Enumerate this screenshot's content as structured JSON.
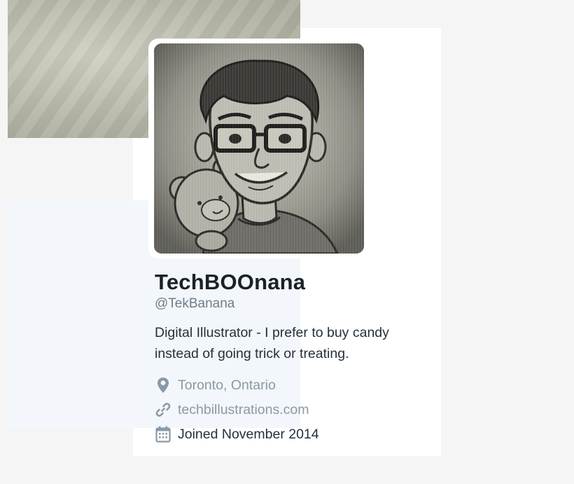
{
  "profile": {
    "display_name": "TechBOOnana",
    "handle": "@TekBanana",
    "bio_line1": "Digital Illustrator - I prefer to buy candy",
    "bio_line2": "instead of going trick or treating.",
    "location": "Toronto, Ontario",
    "website": "techbillustrations.com",
    "joined": "Joined November 2014"
  },
  "icons": {
    "location": "map-pin-icon",
    "website": "link-icon",
    "joined": "calendar-icon"
  },
  "colors": {
    "panel_background": "#f3f6fa",
    "muted_text": "#8a99a5",
    "primary_text": "#1b2126"
  }
}
